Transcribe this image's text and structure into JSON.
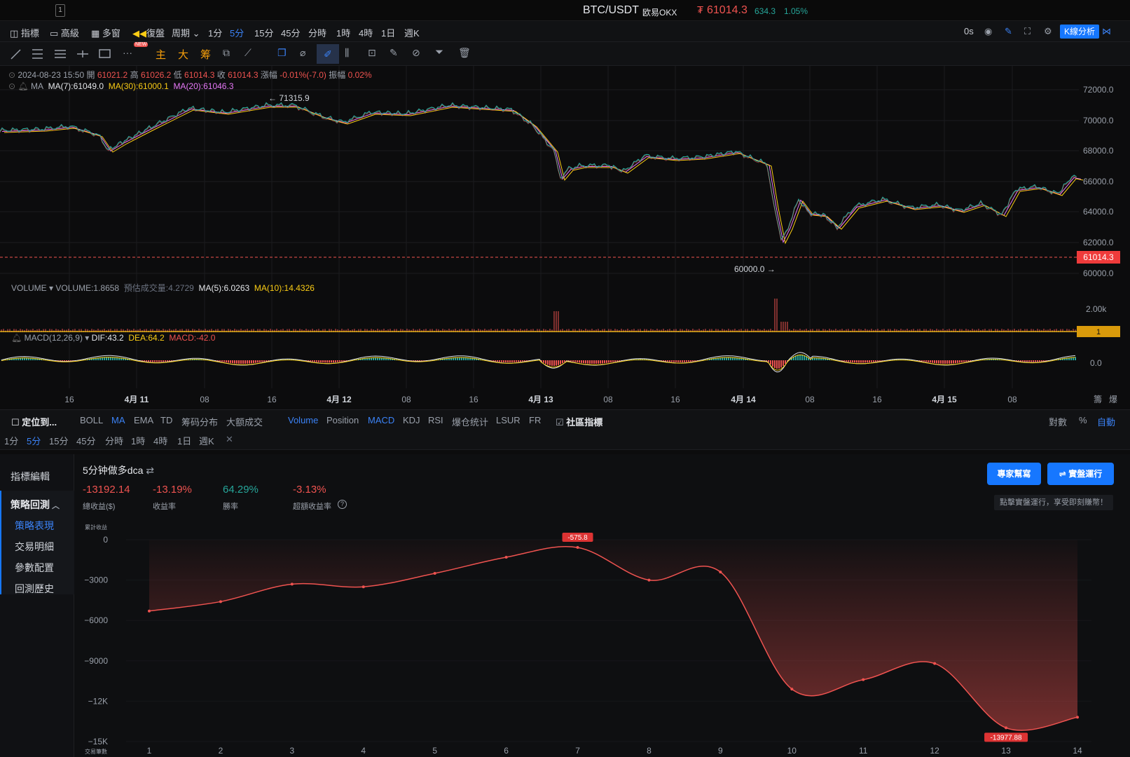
{
  "topbar": {
    "window_index": "1",
    "symbol": "BTC/USDT",
    "exchange": "欧易OKX",
    "currency_sign": "₮",
    "price": "61014.3",
    "change": "634.3",
    "change_pct": "1.05%"
  },
  "toolbar": {
    "indicators": "指標",
    "advanced": "高級",
    "multi_window": "多窗",
    "replay": "復盤",
    "period": "周期",
    "timeframes": [
      "1分",
      "5分",
      "15分",
      "45分",
      "分時",
      "1時",
      "4時",
      "1日",
      "週K"
    ],
    "active_timeframe": "5分",
    "countdown": "0s",
    "kline_analysis": "K線分析"
  },
  "drawing_tools": {
    "new_badge": "NEW",
    "labels": [
      "主",
      "大",
      "筹"
    ]
  },
  "colors": {
    "up": "#26a69a",
    "down": "#ef5350",
    "accent": "#1677ff",
    "ma7": "#e5e7eb",
    "ma30": "#facc15",
    "ma20": "#e879f9"
  },
  "candle_info": {
    "datetime": "2024-08-23 15:50",
    "open_label": "開",
    "open": "61021.2",
    "high_label": "高",
    "high": "61026.2",
    "low_label": "低",
    "low": "61014.3",
    "close_label": "收",
    "close": "61014.3",
    "change_label": "漲幅",
    "change": "-0.01%(-7.0)",
    "amp_label": "振幅",
    "amp": "0.02%"
  },
  "ma_info": {
    "label": "MA",
    "ma7": "MA(7):61049.0",
    "ma30": "MA(30):61000.1",
    "ma20": "MA(20):61046.3"
  },
  "price_axis": {
    "ticks": [
      "72000.0",
      "70000.0",
      "68000.0",
      "66000.0",
      "64000.0",
      "62000.0",
      "60000.0"
    ],
    "current": "61014.3",
    "high_marker": "71315.9",
    "low_marker": "60000.0"
  },
  "volume_info": {
    "label": "VOLUME",
    "volume": "VOLUME:1.8658",
    "estimated": "預估成交量:4.2729",
    "ma5": "MA(5):6.0263",
    "ma10": "MA(10):14.4326",
    "axis_tick": "2.00k",
    "current_tag": "1"
  },
  "macd_info": {
    "label": "MACD(12,26,9)",
    "dif": "DIF:43.2",
    "dea": "DEA:64.2",
    "macd": "MACD:-42.0",
    "axis_tick": "0.0"
  },
  "time_axis": {
    "labels": [
      "16",
      "4月 11",
      "08",
      "16",
      "4月 12",
      "08",
      "16",
      "4月 13",
      "08",
      "16",
      "4月 14",
      "08",
      "16",
      "4月 15",
      "08"
    ],
    "right_labels": [
      "籌",
      "爆"
    ]
  },
  "indicator_bar": {
    "locate": "定位到...",
    "main_items": [
      "BOLL",
      "MA",
      "EMA",
      "TD",
      "筹码分布",
      "大额成交"
    ],
    "active_main": "MA",
    "sub_items": [
      "Volume",
      "Position",
      "MACD",
      "KDJ",
      "RSI",
      "爆仓统计",
      "LSUR",
      "FR"
    ],
    "active_sub": [
      "Volume",
      "MACD"
    ],
    "community": "社區指標",
    "log": "對數",
    "percent": "%",
    "auto": "自動"
  },
  "timeframe_bar2": [
    "1分",
    "5分",
    "15分",
    "45分",
    "分時",
    "1時",
    "4時",
    "1日",
    "週K"
  ],
  "sidebar": {
    "edit": "指標編輯",
    "backtest": "策略回測",
    "items": [
      "策略表現",
      "交易明細",
      "參數配置",
      "回測歷史"
    ],
    "active": "策略表現"
  },
  "strategy": {
    "name": "5分钟做多dca",
    "stats": [
      {
        "value": "-13192.14",
        "label": "總收益($)",
        "color": "#ef5350"
      },
      {
        "value": "-13.19%",
        "label": "收益率",
        "color": "#ef5350"
      },
      {
        "value": "64.29%",
        "label": "勝率",
        "color": "#26a69a"
      },
      {
        "value": "-3.13%",
        "label": "超額收益率",
        "color": "#ef5350"
      }
    ],
    "expert_button": "專家幫寫",
    "live_button": "實盤運行",
    "live_hint": "點擊實盤運行，享受即刻賺幣！"
  },
  "chart_data": {
    "type": "area",
    "ylabel": "累計收益",
    "xlabel": "交易筆數",
    "ylim": [
      -15000,
      0
    ],
    "y_ticks": [
      "0",
      "−3000",
      "−6000",
      "−9000",
      "−12K",
      "−15K"
    ],
    "x": [
      1,
      2,
      3,
      4,
      5,
      6,
      7,
      8,
      9,
      10,
      11,
      12,
      13,
      14
    ],
    "values": [
      -5300,
      -4600,
      -3300,
      -3500,
      -2500,
      -1300,
      -576,
      -3000,
      -2400,
      -11100,
      -10400,
      -9200,
      -13978,
      -13192
    ],
    "max_label": "-575.8",
    "min_label": "-13977.88"
  }
}
